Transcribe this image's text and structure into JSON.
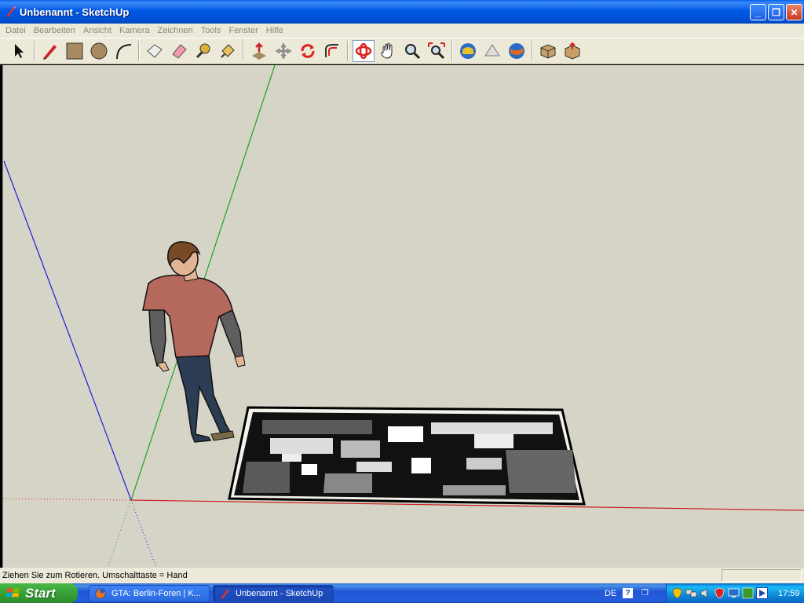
{
  "window": {
    "title": "Unbenannt - SketchUp",
    "minimize_glyph": "_",
    "maximize_glyph": "❐",
    "close_glyph": "✕"
  },
  "menu": [
    "Datei",
    "Bearbeiten",
    "Ansicht",
    "Kamera",
    "Zeichnen",
    "Tools",
    "Fenster",
    "Hilfe"
  ],
  "toolbar": {
    "tools": [
      {
        "name": "select-tool",
        "icon": "arrow-cursor-icon",
        "group": 1,
        "active": false
      },
      {
        "name": "line-tool",
        "icon": "pencil-icon",
        "group": 2,
        "active": false
      },
      {
        "name": "rectangle-tool",
        "icon": "rectangle-icon",
        "group": 2,
        "active": false
      },
      {
        "name": "circle-tool",
        "icon": "circle-icon",
        "group": 2,
        "active": false
      },
      {
        "name": "arc-tool",
        "icon": "arc-icon",
        "group": 2,
        "active": false
      },
      {
        "name": "make-component-tool",
        "icon": "component-icon",
        "group": 3,
        "active": false
      },
      {
        "name": "eraser-tool",
        "icon": "eraser-icon",
        "group": 3,
        "active": false
      },
      {
        "name": "tape-measure-tool",
        "icon": "tape-measure-icon",
        "group": 3,
        "active": false
      },
      {
        "name": "paint-bucket-tool",
        "icon": "paint-bucket-icon",
        "group": 3,
        "active": false
      },
      {
        "name": "push-pull-tool",
        "icon": "push-pull-icon",
        "group": 4,
        "active": false
      },
      {
        "name": "move-tool",
        "icon": "move-icon",
        "group": 4,
        "active": false
      },
      {
        "name": "rotate-tool",
        "icon": "rotate-icon",
        "group": 4,
        "active": false
      },
      {
        "name": "offset-tool",
        "icon": "offset-icon",
        "group": 4,
        "active": false
      },
      {
        "name": "orbit-tool",
        "icon": "orbit-icon",
        "group": 5,
        "active": true
      },
      {
        "name": "pan-tool",
        "icon": "hand-icon",
        "group": 5,
        "active": false
      },
      {
        "name": "zoom-tool",
        "icon": "magnifier-icon",
        "group": 5,
        "active": false
      },
      {
        "name": "zoom-extents-tool",
        "icon": "zoom-extents-icon",
        "group": 5,
        "active": false
      },
      {
        "name": "get-models-tool",
        "icon": "warehouse-get-icon",
        "group": 6,
        "active": false
      },
      {
        "name": "share-model-tool",
        "icon": "warehouse-share-icon",
        "group": 6,
        "active": false
      },
      {
        "name": "google-earth-tool",
        "icon": "google-earth-icon",
        "group": 6,
        "active": false
      },
      {
        "name": "components-window-tool",
        "icon": "components-box-icon",
        "group": 7,
        "active": false
      },
      {
        "name": "share-component-tool",
        "icon": "share-component-icon",
        "group": 7,
        "active": false
      }
    ]
  },
  "colors": {
    "viewport_bg": "#d6d4c6",
    "axis_red": "#c81e1e",
    "axis_green": "#1fa21f",
    "axis_blue": "#2020d8",
    "shirt": "#b5685c",
    "sleeves": "#5e5e5e",
    "jeans": "#2c3c55",
    "skin": "#e2b495",
    "hair": "#7a4a26"
  },
  "status": {
    "hint": "Ziehen Sie zum Rotieren.  Umschalttaste = Hand"
  },
  "taskbar": {
    "start_label": "Start",
    "tasks": [
      {
        "label": "GTA: Berlin-Foren | K...",
        "icon": "firefox-icon",
        "active": false
      },
      {
        "label": "Unbenannt - SketchUp",
        "icon": "sketchup-icon",
        "active": true
      }
    ],
    "language": "DE",
    "help_glyph": "?",
    "clock": "17:59"
  }
}
